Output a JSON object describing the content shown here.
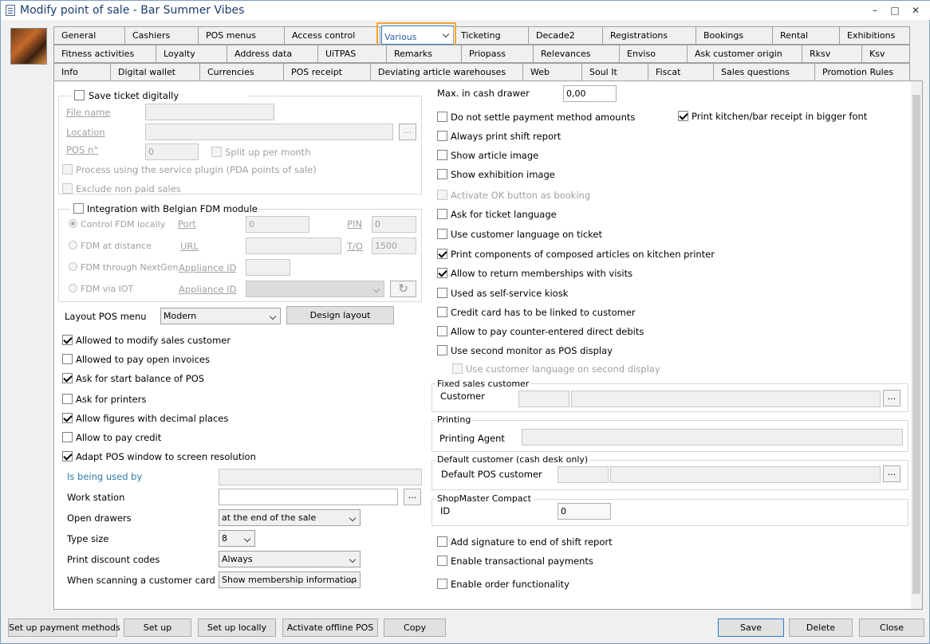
{
  "window": {
    "title": "Modify point of sale - Bar Summer Vibes",
    "minimize": "–",
    "maximize": "□",
    "close": "✕"
  },
  "tabs_row1": [
    "General",
    "Cashiers",
    "POS menus",
    "Access control",
    "Various",
    "Ticketing",
    "Decade2",
    "Registrations",
    "Bookings",
    "Rental",
    "Exhibitions"
  ],
  "tabs_row2": [
    "Fitness activities",
    "Loyalty",
    "Address data",
    "UiTPAS",
    "Remarks",
    "Priopass",
    "Relevances",
    "Enviso",
    "Ask customer origin",
    "Rksv",
    "Ksv"
  ],
  "tabs_row3": [
    "Info",
    "Digital wallet",
    "Currencies",
    "POS receipt",
    "Deviating article warehouses",
    "Web",
    "Soul It",
    "Fiscat",
    "Sales questions",
    "Promotion Rules"
  ],
  "selected_tab": "Various",
  "left": {
    "save_ticket": "Save ticket digitally",
    "file_name": "File name",
    "location": "Location",
    "pos_no": "POS n°",
    "pos_no_value": "0",
    "split_up": "Split up per month",
    "process_plugin": "Process using the service plugin (PDA points of sale)",
    "exclude_non_paid": "Exclude non paid sales",
    "fdm_module": "Integration with Belgian FDM module",
    "control_fdm": "Control FDM locally",
    "fdm_distance": "FDM at distance",
    "fdm_nextgen": "FDM through NextGen",
    "fdm_iot": "FDM via IOT",
    "port": "Port",
    "port_value": "0",
    "pin": "PIN",
    "pin_value": "0",
    "url": "URL",
    "to": "T/O",
    "to_value": "1500",
    "appliance_id": "Appliance ID",
    "appliance_id2": "Appliance ID",
    "layout_pos_menu": "Layout POS menu",
    "layout_value": "Modern",
    "design_layout": "Design layout",
    "allowed_modify": "Allowed to modify sales customer",
    "allowed_pay_open": "Allowed to pay open invoices",
    "ask_start_balance": "Ask for start balance of POS",
    "ask_printers": "Ask for printers",
    "allow_decimal": "Allow figures with decimal places",
    "allow_credit": "Allow to pay credit",
    "adapt_window": "Adapt POS window to screen resolution",
    "being_used_by": "Is being used by",
    "work_station": "Work station",
    "open_drawers": "Open drawers",
    "open_drawers_value": "at the end of the sale",
    "type_size": "Type size",
    "type_size_value": "8",
    "print_discount": "Print discount codes",
    "print_discount_value": "Always",
    "scanning_card": "When scanning a customer card",
    "scanning_card_value": "Show membership information"
  },
  "right": {
    "max_cash": "Max. in cash drawer",
    "max_cash_value": "0,00",
    "no_settle": "Do not settle payment method amounts",
    "print_kitchen_big": "Print kitchen/bar receipt in bigger font",
    "always_shift": "Always print shift report",
    "show_article_img": "Show article image",
    "show_exhibition_img": "Show exhibition image",
    "activate_ok": "Activate OK button as booking",
    "ask_ticket_lang": "Ask for ticket language",
    "use_cust_lang": "Use customer language on ticket",
    "print_components": "Print components of composed articles on kitchen printer",
    "allow_return": "Allow to return memberships with visits",
    "self_service": "Used as self-service kiosk",
    "credit_card_link": "Credit card has to be linked to customer",
    "counter_debits": "Allow to pay counter-entered direct debits",
    "second_monitor": "Use second monitor as POS display",
    "cust_lang_second": "Use customer language on second display",
    "fixed_sales": "Fixed sales customer",
    "customer": "Customer",
    "printing": "Printing",
    "printing_agent": "Printing Agent",
    "default_customer": "Default customer (cash desk only)",
    "default_pos_customer": "Default POS customer",
    "shopmaster": "ShopMaster Compact",
    "id": "ID",
    "id_value": "0",
    "add_signature": "Add signature to end of shift report",
    "transactional": "Enable transactional payments",
    "order_func": "Enable order functionality"
  },
  "dots": "...",
  "bottom": {
    "setup_payment": "Set up payment methods",
    "setup": "Set up",
    "setup_locally": "Set up locally",
    "activate_offline": "Activate offline POS",
    "copy": "Copy",
    "save": "Save",
    "delete": "Delete",
    "close": "Close"
  }
}
